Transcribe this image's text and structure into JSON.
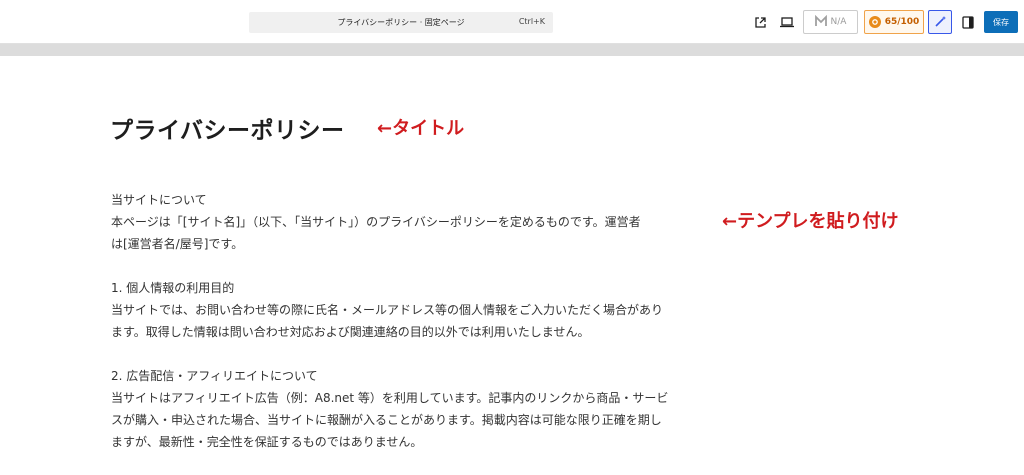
{
  "toolbar": {
    "command_title": "プライバシーポリシー · 固定ページ",
    "command_shortcut": "Ctrl+K",
    "na_label": "N/A",
    "score_label": "65/100",
    "save_label": "保存"
  },
  "page": {
    "title": "プライバシーポリシー"
  },
  "annotations": {
    "title_note": "←タイトル",
    "template_note": "←テンプレを貼り付け"
  },
  "content": {
    "sections": [
      {
        "lines": [
          "当サイトについて",
          "本ページは「[サイト名]」（以下、「当サイト」）のプライバシーポリシーを定めるものです。運営者",
          "は[運営者名/屋号]です。"
        ]
      },
      {
        "lines": [
          "1. 個人情報の利用目的",
          "当サイトでは、お問い合わせ等の際に氏名・メールアドレス等の個人情報をご入力いただく場合があり",
          "ます。取得した情報は問い合わせ対応および関連連絡の目的以外では利用いたしません。"
        ]
      },
      {
        "lines": [
          "2. 広告配信・アフィリエイトについて",
          "当サイトはアフィリエイト広告（例：A8.net 等）を利用しています。記事内のリンクから商品・サービ",
          "スが購入・申込された場合、当サイトに報酬が入ることがあります。掲載内容は可能な限り正確を期し",
          "ますが、最新性・完全性を保証するものではありません。"
        ]
      }
    ]
  },
  "icons": {
    "external": "external-link-icon",
    "preview": "desktop-preview-icon",
    "seo": "seo-logo-icon",
    "score": "score-icon",
    "wand": "magic-wand-icon",
    "sidebar": "sidebar-toggle-icon"
  },
  "colors": {
    "save_bg": "#0d6eb8",
    "annotation": "#d01c1f",
    "score_border": "#f0a34a",
    "wand_border": "#3858e9"
  }
}
